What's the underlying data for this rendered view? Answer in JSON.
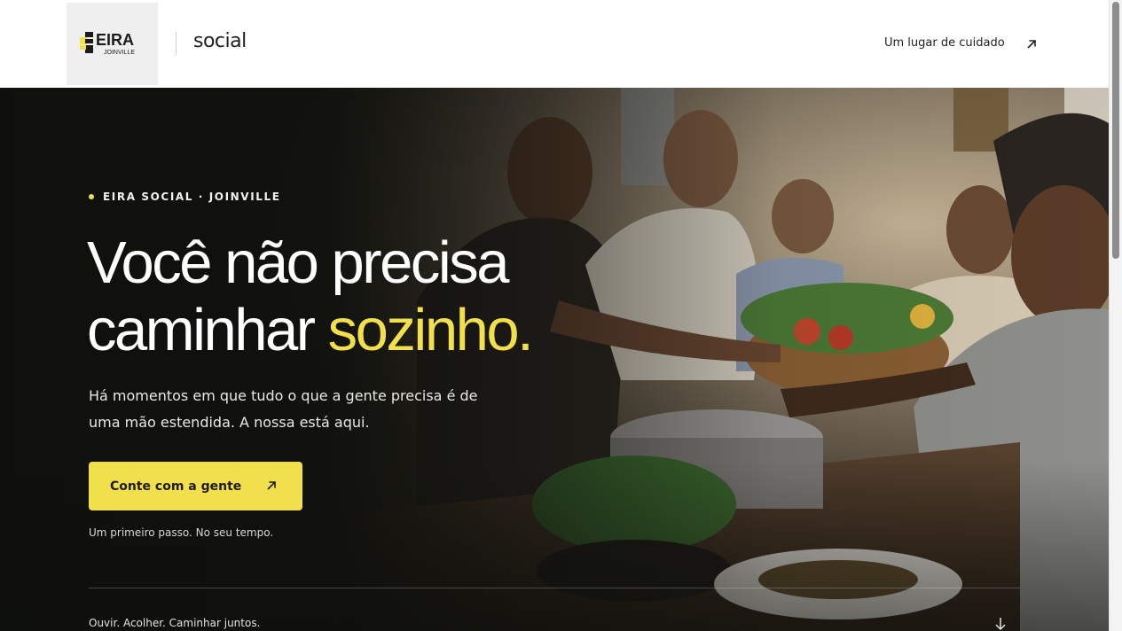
{
  "header": {
    "logo_word": "EIRA",
    "logo_sub": "JOINVILLE",
    "brand_suffix": "social",
    "link_label": "Um lugar de cuidado",
    "link_icon": "arrow-up-right-icon"
  },
  "hero": {
    "eyebrow": "EIRA SOCIAL · JOINVILLE",
    "headline_line1": "Você não precisa",
    "headline_line2_start": "caminhar ",
    "headline_accent": "sozinho.",
    "lead": "Há momentos em que tudo o que a gente precisa é de uma mão estendida. A nossa está aqui.",
    "cta_label": "Conte com a gente",
    "cta_icon": "arrow-up-right-icon",
    "cta_note": "Um primeiro passo. No seu tempo.",
    "tagline": "Ouvir. Acolher. Caminhar juntos.",
    "scroll_icon": "arrow-down-icon"
  },
  "colors": {
    "accent": "#f1e04c",
    "hero_dark": "#0e0f0c",
    "text_dark": "#1c1c1a"
  }
}
